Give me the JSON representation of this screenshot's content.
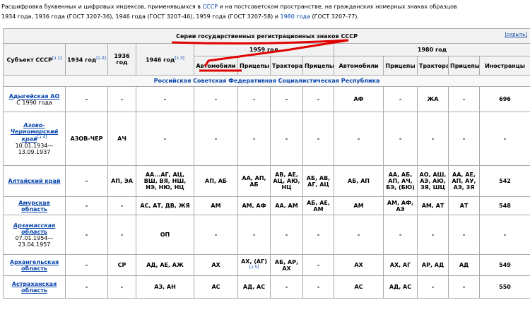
{
  "intro": {
    "part1": "Расшифровка буквенных и цифровых индексов, применявшихся в ",
    "link1": "СССР",
    "part2": " и на постсоветском пространстве, на гражданских номерных знаках образцов",
    "line2": "1934 года, 1936 года (ГОСТ 3207-36), 1946 года (ГОСТ 3207-46), 1959 года (ГОСТ 3207-58) и ",
    "link2": "1980 года",
    "part3": " (ГОСТ 3207-77)."
  },
  "table": {
    "title": "Серии государственных регистрационных знаков СССР",
    "hide_label": "[скрыть]",
    "headers": {
      "subject": "Субъект СССР",
      "subject_ref": "[з 1]",
      "y1934": "1934 год",
      "y1934_ref": "[з 2]",
      "y1936": "1936 год",
      "y1946": "1946 год",
      "y1946_ref": "[з 3]",
      "y1959": "1959 год",
      "y1980": "1980 год",
      "sub1959": [
        "Автомобили",
        "Прицепы",
        "Трактора",
        "Прицепы"
      ],
      "sub1980": [
        "Автомобили",
        "Прицепы",
        "Трактора",
        "Прицепы",
        "Иностранцы"
      ]
    },
    "group": "Российская Советская Федеративная Социалистическая Республика",
    "rows": [
      {
        "name": "Адыгейская АО",
        "ref": "",
        "date": "С 1990 года",
        "cells": [
          "-",
          "-",
          "-",
          "-",
          "-",
          "-",
          "-",
          "АФ",
          "-",
          "ЖА",
          "-",
          "696"
        ]
      },
      {
        "name": "Азово-Черноморский край",
        "ref": "[з 4]",
        "date": "10.01.1934—13.09.1937",
        "cells": [
          "АЗОВ-ЧЕР",
          "АЧ",
          "-",
          "-",
          "-",
          "-",
          "-",
          "-",
          "-",
          "-",
          "-",
          "-"
        ]
      },
      {
        "name": "Алтайский край",
        "ref": "",
        "date": "",
        "cells": [
          "-",
          "АП, ЭА",
          "АА...АГ, АЦ, ВШ, ВЯ, НШ, НЭ, НЮ, НЦ",
          "АП, АБ",
          "АА, АП, АБ",
          "АВ, АЕ, АЦ, АЮ, НЦ",
          "АБ, АВ, АГ, АЦ",
          "АБ, АП",
          "АА, АБ, АП, АЧ, БЭ, (БЮ)",
          "АО, АШ, АЭ, АЮ, ЗЯ, ШЦ",
          "АА, АЕ, АП, АУ, АЭ, ЗЯ",
          "542"
        ]
      },
      {
        "name": "Амурская область",
        "ref": "",
        "date": "",
        "cells": [
          "-",
          "-",
          "АС, АТ, ДВ, ЖЯ",
          "АМ",
          "АМ, АФ",
          "АА, АМ",
          "АБ, АЕ, АМ",
          "АМ",
          "АМ, АФ, АЭ",
          "АМ, АТ",
          "АТ",
          "548"
        ]
      },
      {
        "name": "Арзамасская область",
        "ref": "",
        "date": "07.01.1954—23.04.1957",
        "cells": [
          "-",
          "-",
          "ОП",
          "-",
          "-",
          "-",
          "-",
          "-",
          "-",
          "-",
          "-",
          "-"
        ]
      },
      {
        "name": "Архангельская область",
        "ref": "",
        "date": "",
        "cells": [
          "-",
          "СР",
          "АД, АЕ, АЖ",
          "АХ",
          "АХ, (АГ)",
          "АБ, АР, АХ",
          "-",
          "АХ",
          "АХ, АГ",
          "АР, АД",
          "АД",
          "549"
        ]
      },
      {
        "name": "Астраханская область",
        "ref": "",
        "date": "",
        "cells": [
          "-",
          "-",
          "АЗ, АН",
          "АС",
          "АД, АС",
          "-",
          "-",
          "АС",
          "АД, АС",
          "-",
          "-",
          "550"
        ]
      }
    ],
    "cell_ref": "[з 5]"
  },
  "colors": {
    "link": "#0645ad",
    "header_bg": "#f2f2f2",
    "annotation": "#e00000"
  }
}
